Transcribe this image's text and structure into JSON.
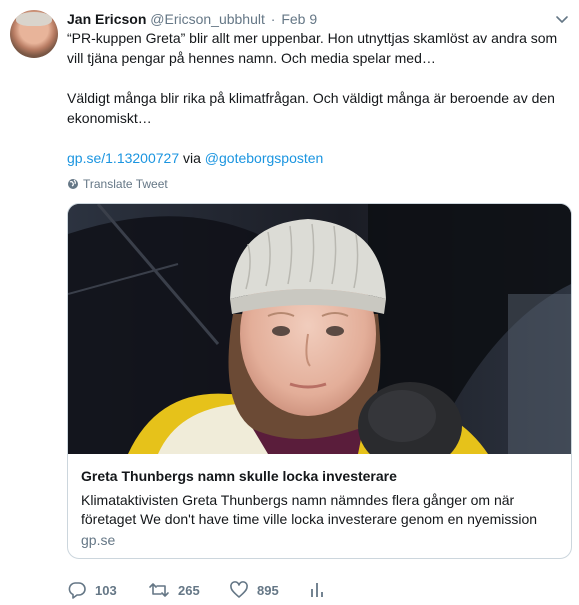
{
  "tweet": {
    "author_name": "Jan Ericson",
    "author_handle": "@Ericson_ubbhult",
    "separator": "·",
    "date": "Feb 9",
    "line1": "“PR-kuppen Greta” blir allt mer uppenbar. Hon utnyttjas skamlöst av andra som vill tjäna pengar på hennes namn. Och media spelar med…",
    "line2": "Väldigt många blir rika på klimatfrågan. Och väldigt många är beroende av den ekonomiskt…",
    "link_url": "gp.se/1.13200727",
    "via_text": "via",
    "via_mention": "@goteborgsposten",
    "translate_label": "Translate Tweet"
  },
  "card": {
    "title": "Greta Thunbergs namn skulle locka investerare",
    "description": "Klimataktivisten Greta Thunbergs namn nämndes flera gånger om när företaget We don't have time ville locka investerare genom en nyemission",
    "domain": "gp.se"
  },
  "actions": {
    "replies": "103",
    "retweets": "265",
    "likes": "895"
  },
  "colors": {
    "link": "#1b95e0",
    "muted": "#657786",
    "border": "#ccd6dd"
  },
  "icons": [
    "chevron-down-icon",
    "globe-icon",
    "reply-icon",
    "retweet-icon",
    "like-icon",
    "analytics-icon"
  ]
}
